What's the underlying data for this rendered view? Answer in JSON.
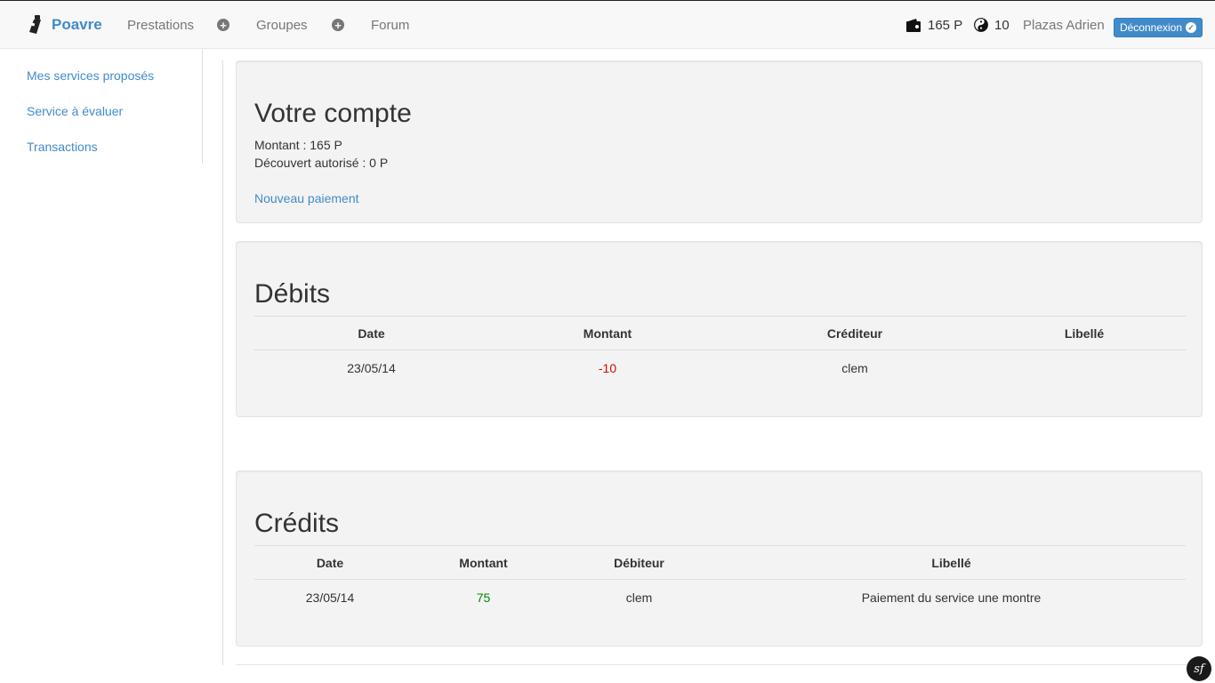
{
  "navbar": {
    "brand": "Poavre",
    "links": [
      "Prestations",
      "Groupes",
      "Forum"
    ],
    "wallet_icon": "wallet-icon",
    "wallet_amount": "165 P",
    "karma_icon": "yin-yang-icon",
    "karma_value": "10",
    "user_name": "Plazas Adrien",
    "logout_label": "Déconnexion"
  },
  "sidebar": {
    "items": [
      {
        "label": "Mes services proposés"
      },
      {
        "label": "Service à évaluer"
      },
      {
        "label": "Transactions"
      }
    ]
  },
  "account": {
    "title": "Votre compte",
    "balance": "Montant : 165 P",
    "overdraft": "Découvert autorisé : 0 P",
    "new_payment": "Nouveau paiement"
  },
  "debits": {
    "title": "Débits",
    "columns": [
      "Date",
      "Montant",
      "Créditeur",
      "Libellé"
    ],
    "rows": [
      {
        "date": "23/05/14",
        "amount": "-10",
        "party": "clem",
        "label": ""
      }
    ]
  },
  "credits": {
    "title": "Crédits",
    "columns": [
      "Date",
      "Montant",
      "Débiteur",
      "Libellé"
    ],
    "rows": [
      {
        "date": "23/05/14",
        "amount": "75",
        "party": "clem",
        "label": "Paiement du service une montre"
      }
    ]
  },
  "colors": {
    "accent": "#428bca",
    "negative": "#dd0000",
    "positive": "#008800"
  },
  "footer": {
    "badge": "sf"
  }
}
